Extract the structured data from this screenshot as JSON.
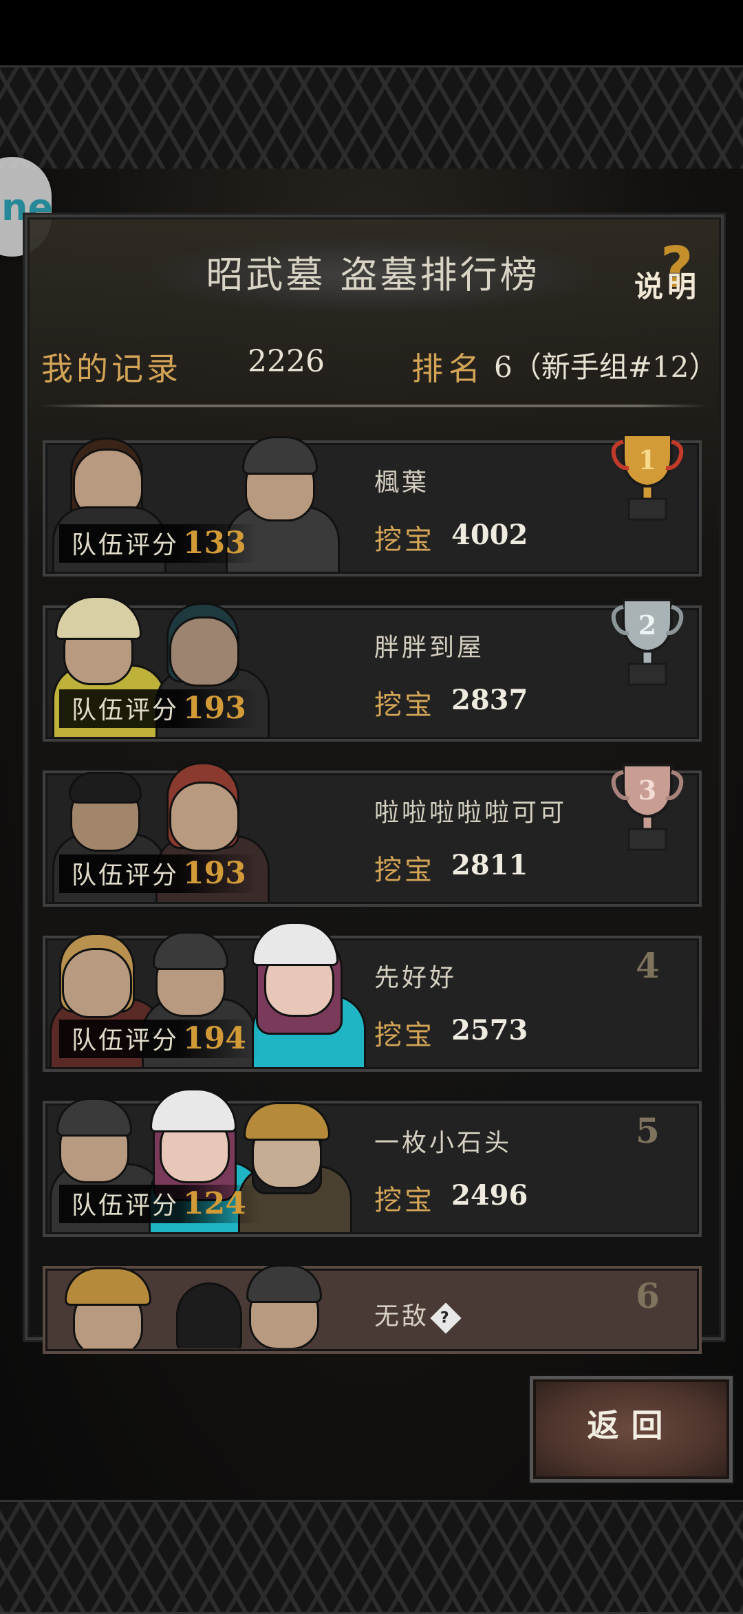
{
  "floating_button": {
    "label": "ne"
  },
  "title": "昭武墓 盗墓排行榜",
  "help": {
    "symbol": "?",
    "label": "说明"
  },
  "my_record": {
    "label": "我的记录",
    "value": "2226"
  },
  "rank": {
    "label": "排名",
    "value": "6（新手组#12）"
  },
  "score_label": "队伍评分",
  "dig_label": "挖宝",
  "entries": [
    {
      "rank": "1",
      "name": "楓葉",
      "team_score": "133",
      "dig": "4002",
      "trophy": "gold-trophy"
    },
    {
      "rank": "2",
      "name": "胖胖到屋",
      "team_score": "193",
      "dig": "2837",
      "trophy": "silver-trophy"
    },
    {
      "rank": "3",
      "name": "啦啦啦啦啦可可",
      "team_score": "193",
      "dig": "2811",
      "trophy": "bronze-trophy"
    },
    {
      "rank": "4",
      "name": "先好好",
      "team_score": "194",
      "dig": "2573"
    },
    {
      "rank": "5",
      "name": "一枚小石头",
      "team_score": "124",
      "dig": "2496"
    },
    {
      "rank": "6",
      "name": "无敌",
      "badge": "?"
    }
  ],
  "back_button": "返回",
  "colors": {
    "gold": "#d39b38",
    "label_gold": "#d4a557",
    "self_row": "#4a3a36"
  }
}
